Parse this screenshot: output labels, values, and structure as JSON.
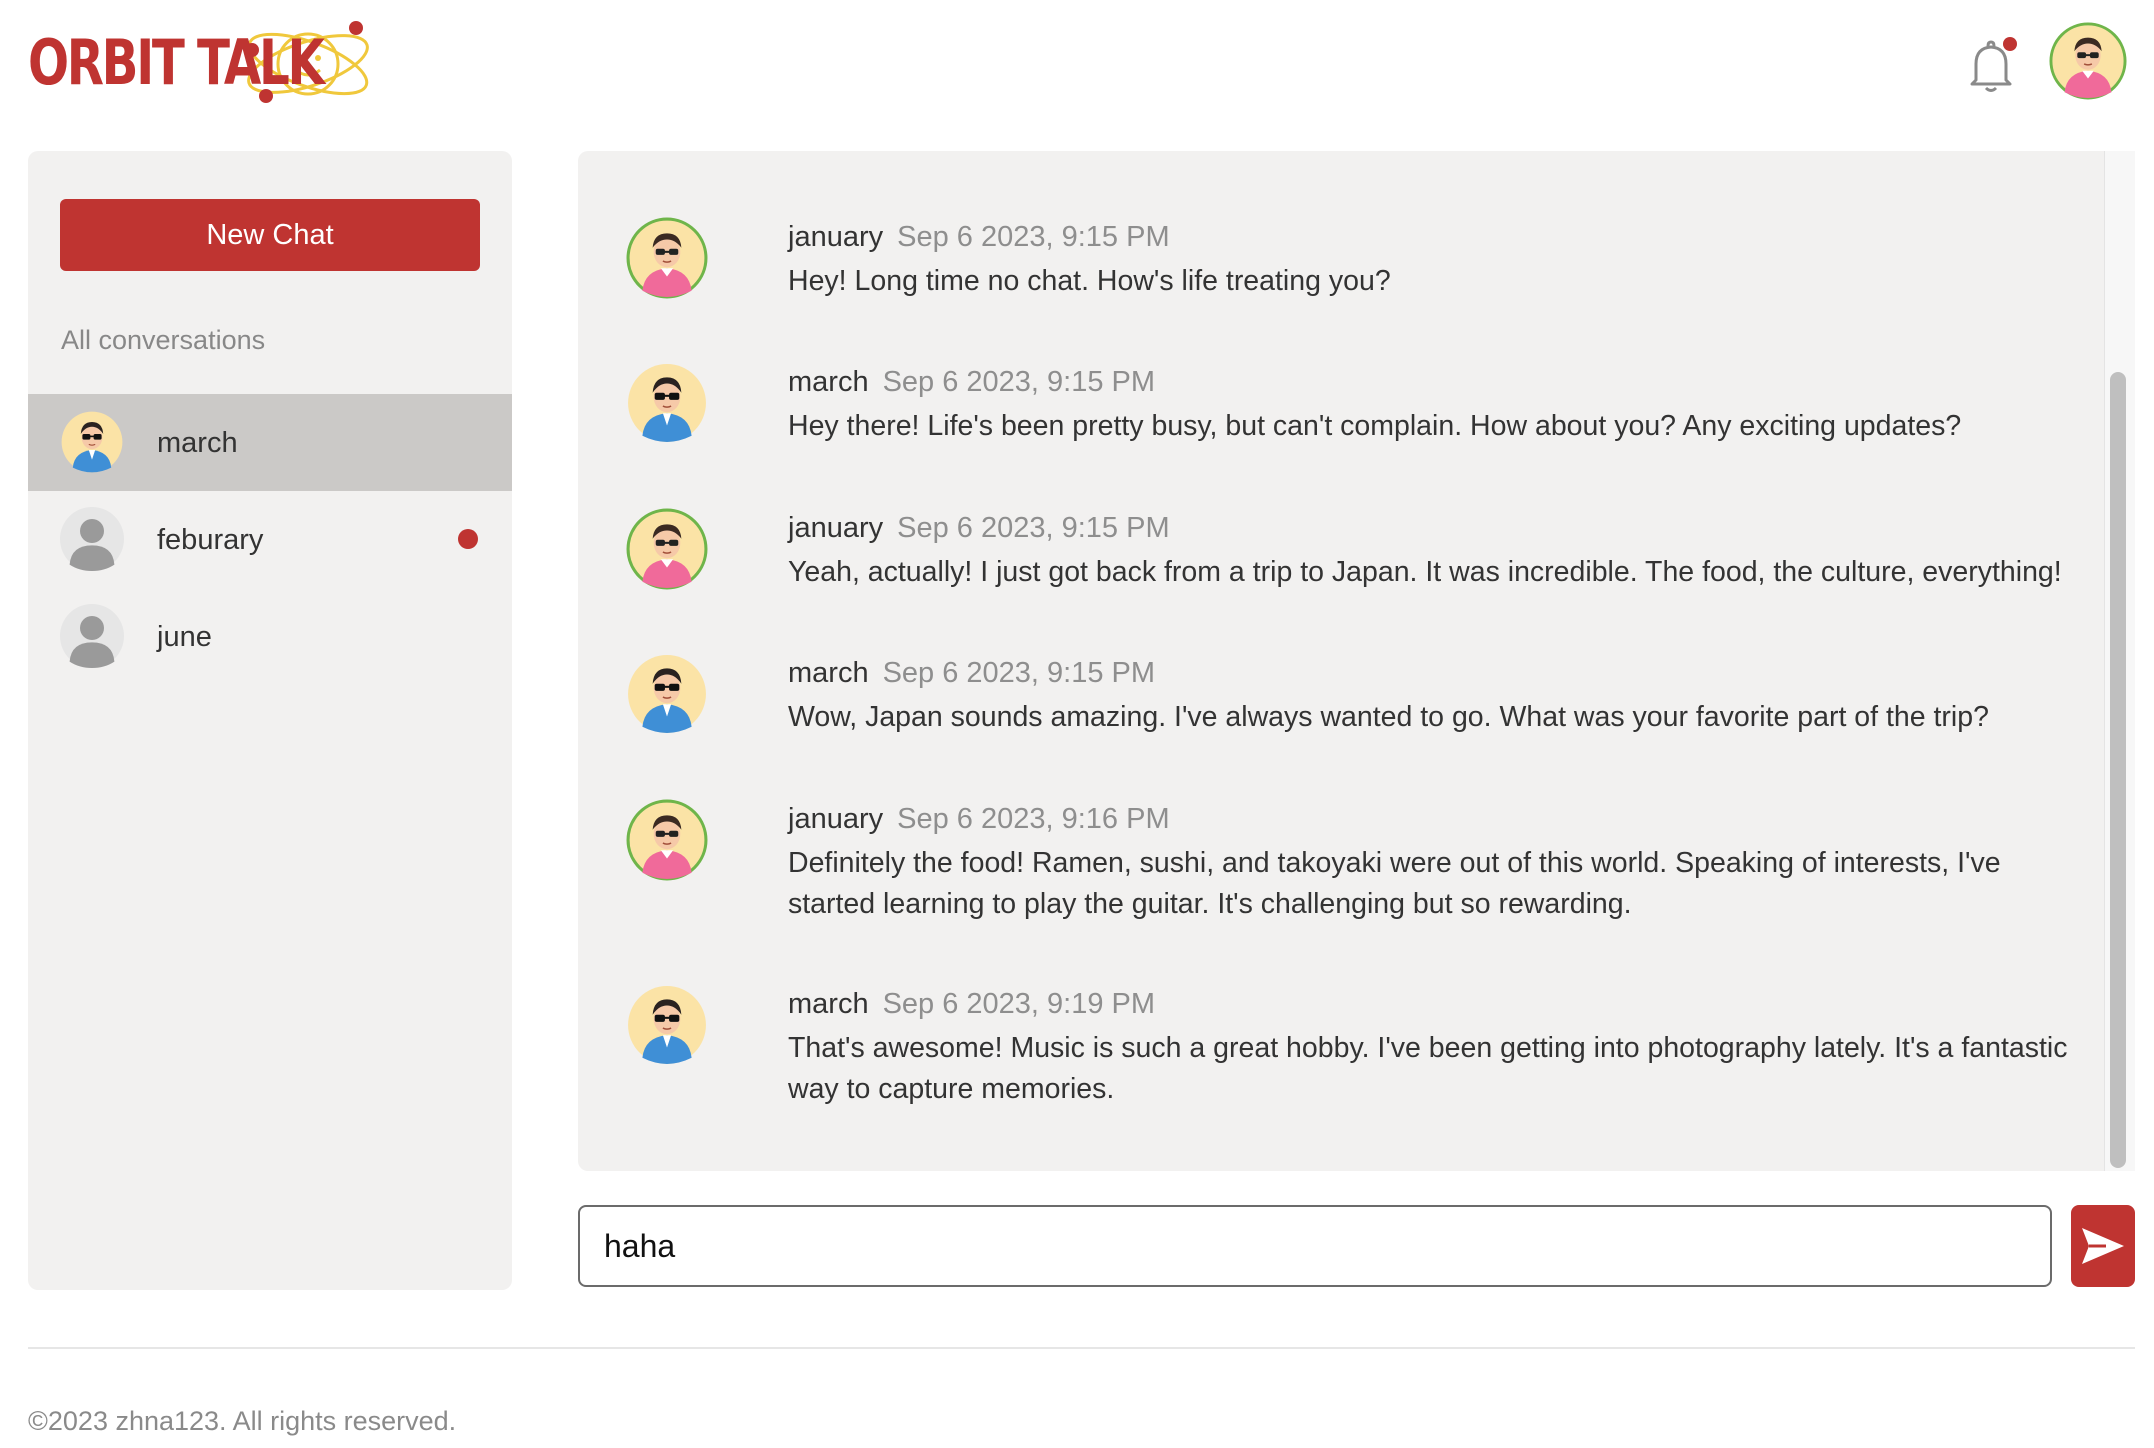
{
  "app": {
    "logo_text": "ORBIT TALK",
    "brand_color": "#bf3431"
  },
  "header": {
    "bell_icon": "bell-icon",
    "has_notification": true,
    "user_avatar": "avatar-january"
  },
  "sidebar": {
    "new_chat_label": "New Chat",
    "section_title": "All conversations",
    "conversations": [
      {
        "name": "march",
        "active": true,
        "unread": false,
        "avatar": "avatar-march"
      },
      {
        "name": "feburary",
        "active": false,
        "unread": true,
        "avatar": "avatar-placeholder"
      },
      {
        "name": "june",
        "active": false,
        "unread": false,
        "avatar": "avatar-placeholder"
      }
    ]
  },
  "chat": {
    "messages": [
      {
        "author": "january",
        "time": "Sep 6 2023, 9:15 PM",
        "text": "Hey! Long time no chat. How's life treating you?"
      },
      {
        "author": "march",
        "time": "Sep 6 2023, 9:15 PM",
        "text": "Hey there! Life's been pretty busy, but can't complain. How about you? Any exciting updates?"
      },
      {
        "author": "january",
        "time": "Sep 6 2023, 9:15 PM",
        "text": "Yeah, actually! I just got back from a trip to Japan. It was incredible. The food, the culture, everything!"
      },
      {
        "author": "march",
        "time": "Sep 6 2023, 9:15 PM",
        "text": "Wow, Japan sounds amazing. I've always wanted to go. What was your favorite part of the trip?"
      },
      {
        "author": "january",
        "time": "Sep 6 2023, 9:16 PM",
        "text": "Definitely the food! Ramen, sushi, and takoyaki were out of this world. Speaking of interests, I've started learning to play the guitar. It's challenging but so rewarding."
      },
      {
        "author": "march",
        "time": "Sep 6 2023, 9:19 PM",
        "text": "That's awesome! Music is such a great hobby. I've been getting into photography lately. It's a fantastic way to capture memories."
      }
    ],
    "input_value": "haha",
    "send_icon": "send-icon"
  },
  "footer": {
    "copyright": "©2023 zhna123. All rights reserved."
  }
}
